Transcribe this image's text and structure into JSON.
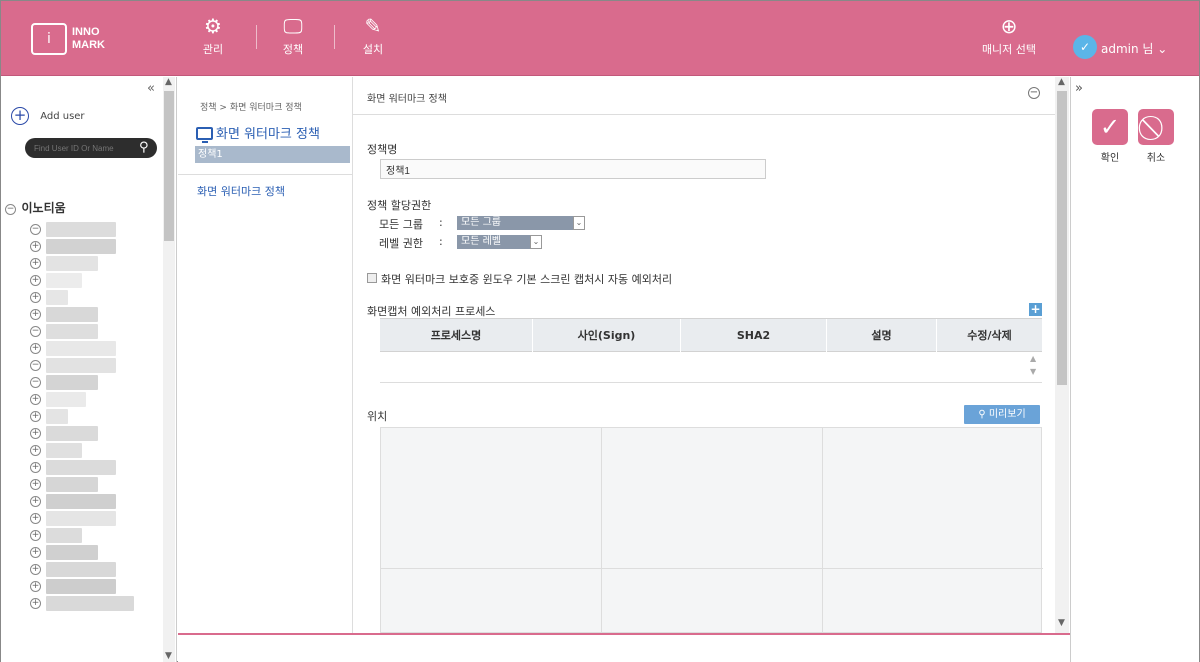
{
  "header": {
    "logo_mark": "i",
    "logo_line1": "INNO",
    "logo_line2": "MARK",
    "nav": [
      {
        "label": "관리",
        "icon": "gear-icon"
      },
      {
        "label": "정책",
        "icon": "monitor-icon"
      },
      {
        "label": "설치",
        "icon": "wrench-icon"
      }
    ],
    "manager_select": "매니저 선택",
    "user_name": "admin 님"
  },
  "left": {
    "add_user": "Add user",
    "search_placeholder": "Find User ID Or Name",
    "tree_root": "이노티움"
  },
  "mid": {
    "breadcrumb": "정책 > 화면 워터마크 정책",
    "policy_title": "화면 워터마크 정책",
    "policy_item": "정책1",
    "menu_link": "화면 워터마크 정책"
  },
  "content": {
    "title": "화면 워터마크 정책",
    "policy_name_label": "정책명",
    "policy_name_value": "정책1",
    "assign_label": "정책 할당권한",
    "group_label": "모든 그룹",
    "group_colon": ":",
    "group_value": "모든 그룹",
    "level_label": "레벨 권한",
    "level_colon": ":",
    "level_value": "모든 레벨",
    "checkbox_label": "화면 워터마크 보호중 윈도우 기본 스크린 캡처시 자동 예외처리",
    "process_section": "화면캡처 예외처리 프로세스",
    "table_headers": [
      "프로세스명",
      "사인(Sign)",
      "SHA2",
      "설명",
      "수정/삭제"
    ],
    "position_label": "위치",
    "preview_button": "미리보기"
  },
  "actions": {
    "confirm": "확인",
    "cancel": "취소"
  },
  "colors": {
    "brand": "#d96b8d",
    "link": "#2b5fb3",
    "selector": "#8a97a9"
  }
}
